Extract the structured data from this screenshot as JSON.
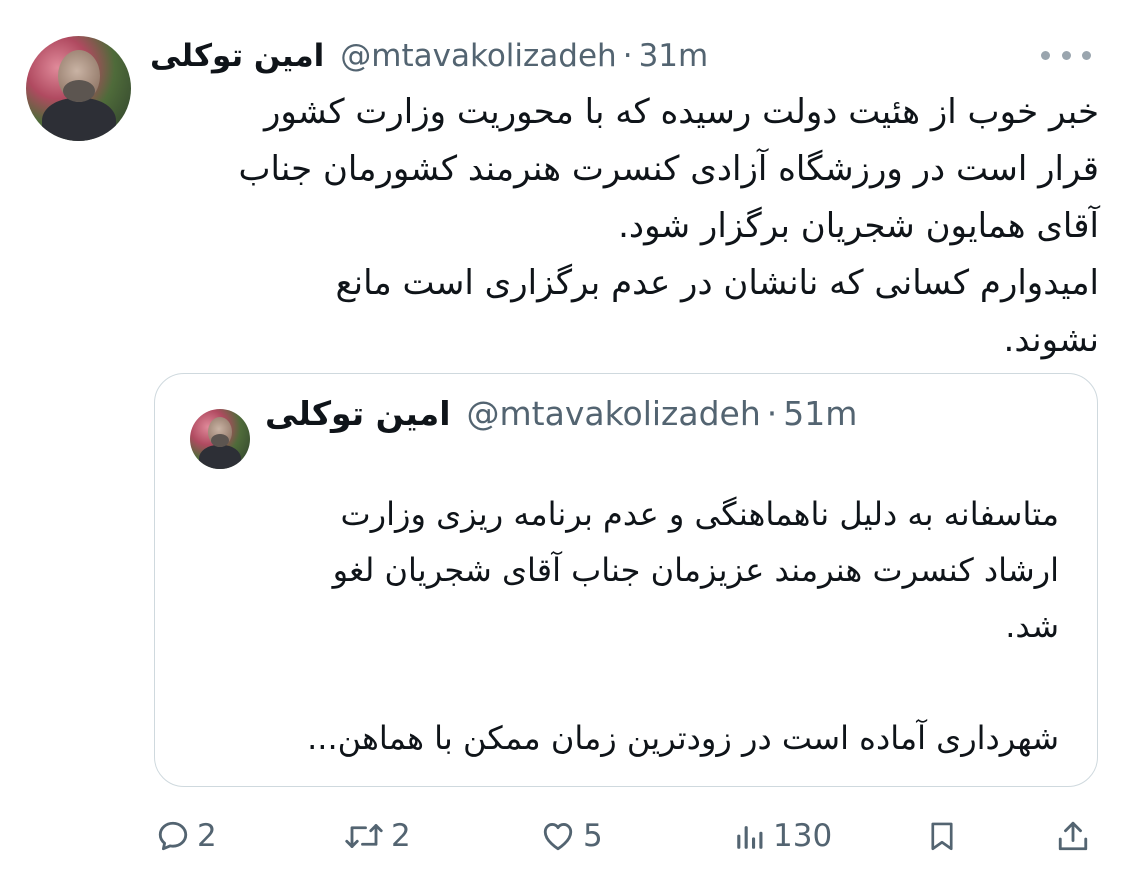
{
  "tweet": {
    "author": {
      "display_name": "امین توکلی",
      "handle": "@mtavakolizadeh",
      "separator": "·",
      "time": "31m"
    },
    "text_lines": [
      "خبر خوب از هئیت دولت رسیده که با محوریت وزارت کشور",
      "قرار است در ورزشگاه آزادی کنسرت هنرمند کشورمان جناب",
      "آقای همایون شجریان برگزار شود.",
      "امیدوارم کسانی که نانشان در عدم برگزاری است مانع",
      "نشوند."
    ]
  },
  "quoted_tweet": {
    "author": {
      "display_name": "امین توکلی",
      "handle": "@mtavakolizadeh",
      "separator": "·",
      "time": "51m"
    },
    "text_lines": [
      "متاسفانه به دلیل ناهماهنگی و عدم برنامه ریزی وزارت",
      "ارشاد کنسرت هنرمند عزیزمان جناب آقای شجریان لغو",
      "شد."
    ],
    "text_truncated": "شهرداری آماده است در زودترین زمان ممکن با هماهن..."
  },
  "actions": {
    "reply_count": "2",
    "retweet_count": "2",
    "like_count": "5",
    "views_count": "130"
  },
  "icons": {
    "more": "more-horizontal-icon",
    "reply": "reply-icon",
    "retweet": "retweet-icon",
    "like": "heart-icon",
    "views": "views-icon",
    "bookmark": "bookmark-icon",
    "share": "share-icon"
  },
  "colors": {
    "text": "#0f1419",
    "secondary": "#536471",
    "border": "#cfd9de"
  }
}
